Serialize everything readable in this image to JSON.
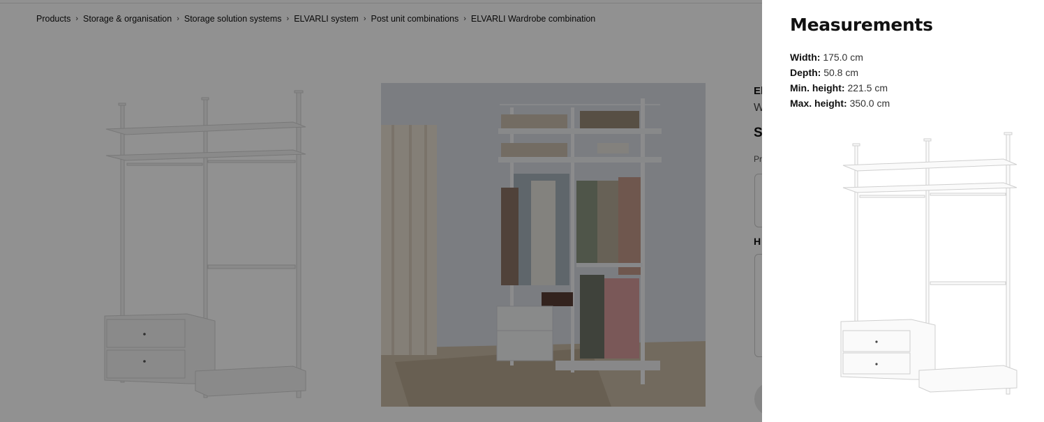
{
  "breadcrumb": [
    "Products",
    "Storage & organisation",
    "Storage solution systems",
    "ELVARLI system",
    "Post unit combinations",
    "ELVARLI Wardrobe combination"
  ],
  "breadcrumb_separator": "›",
  "product_partial": {
    "name_fragment": "El",
    "subtitle_fragment": "W",
    "price_fragment": "S",
    "small_fragment": "Pr",
    "heading_fragment": "H"
  },
  "measurements": {
    "title": "Measurements",
    "width_label": "Width:",
    "width_value": "175.0 cm",
    "depth_label": "Depth:",
    "depth_value": "50.8 cm",
    "min_height_label": "Min. height:",
    "min_height_value": "221.5 cm",
    "max_height_label": "Max. height:",
    "max_height_value": "350.0 cm"
  }
}
